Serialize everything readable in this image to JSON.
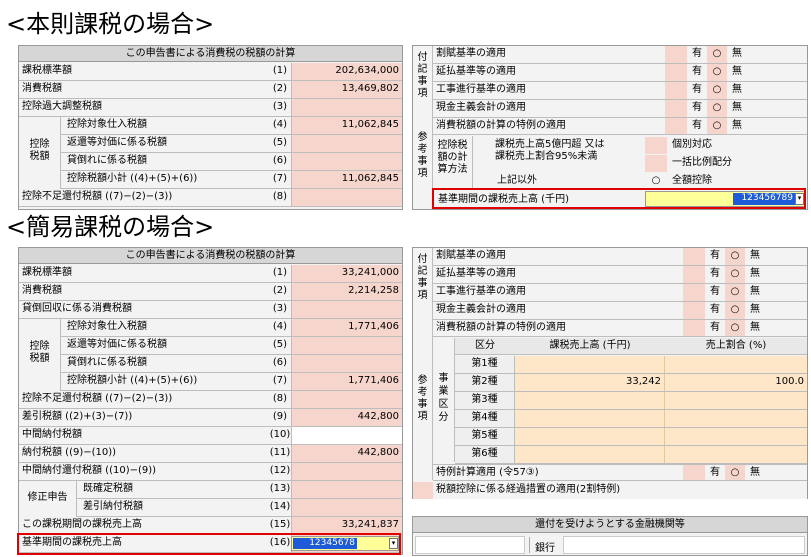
{
  "headings": {
    "honsoku": "<本則課税の場合>",
    "kani": "<簡易課税の場合>"
  },
  "calc": {
    "title": "この申告書による消費税の税額の計算",
    "koujo_group": "控除\n税額",
    "shusei_group": "修正申告"
  },
  "top_rows": [
    {
      "label": "課税標準額",
      "no": "(1)",
      "value": "202,634,000"
    },
    {
      "label": "消費税額",
      "no": "(2)",
      "value": "13,469,802"
    },
    {
      "label": "控除過大調整税額",
      "no": "(3)",
      "value": ""
    },
    {
      "label": "控除対象仕入税額",
      "no": "(4)",
      "value": "11,062,845"
    },
    {
      "label": "返還等対価に係る税額",
      "no": "(5)",
      "value": ""
    },
    {
      "label": "貸倒れに係る税額",
      "no": "(6)",
      "value": ""
    },
    {
      "label": "控除税額小計 ((4)+(5)+(6))",
      "no": "(7)",
      "value": "11,062,845"
    },
    {
      "label": "控除不足還付税額 ((7)−(2)−(3))",
      "no": "(8)",
      "value": ""
    }
  ],
  "bottom_rows": [
    {
      "label": "課税標準額",
      "no": "(1)",
      "value": "33,241,000"
    },
    {
      "label": "消費税額",
      "no": "(2)",
      "value": "2,214,258"
    },
    {
      "label": "貸倒回収に係る消費税額",
      "no": "(3)",
      "value": ""
    },
    {
      "label": "控除対象仕入税額",
      "no": "(4)",
      "value": "1,771,406"
    },
    {
      "label": "返還等対価に係る税額",
      "no": "(5)",
      "value": ""
    },
    {
      "label": "貸倒れに係る税額",
      "no": "(6)",
      "value": ""
    },
    {
      "label": "控除税額小計 ((4)+(5)+(6))",
      "no": "(7)",
      "value": "1,771,406"
    },
    {
      "label": "控除不足還付税額 ((7)−(2)−(3))",
      "no": "(8)",
      "value": ""
    },
    {
      "label": "差引税額 ((2)+(3)−(7))",
      "no": "(9)",
      "value": "442,800"
    },
    {
      "label": "中間納付税額",
      "no": "(10)",
      "value": ""
    },
    {
      "label": "納付税額 ((9)−(10))",
      "no": "(11)",
      "value": "442,800"
    },
    {
      "label": "中間納付還付税額 ((10)−(9))",
      "no": "(12)",
      "value": ""
    },
    {
      "label": "既確定税額",
      "no": "(13)",
      "value": ""
    },
    {
      "label": "差引納付税額",
      "no": "(14)",
      "value": ""
    },
    {
      "label": "この課税期間の課税売上高",
      "no": "(15)",
      "value": "33,241,837"
    },
    {
      "label": "基準期間の課税売上高",
      "no": "(16)",
      "value": "12345678"
    }
  ],
  "fuki": {
    "vertical": "付\n記\n事\n項",
    "items": [
      "割賦基準の適用",
      "延払基準等の適用",
      "工事進行基準の適用",
      "現金主義会計の適用"
    ],
    "yes": "有",
    "circle": "○",
    "no": "無"
  },
  "sanko_top": {
    "vertical": "参\n考\n事\n項",
    "tokurei": "消費税額の計算の特例の適用",
    "hoho": "控除税\n額の計\n算方法",
    "cond": "課税売上高5億円超 又は\n課税売上割合95%未満",
    "kobetsu": "個別対応",
    "ikkatsu": "一括比例配分",
    "jouki_igai": "上記以外",
    "zengaku": "全額控除",
    "kijun_label": "基準期間の課税売上高 (千円)",
    "kijun_value": "123456789"
  },
  "sanko_bottom": {
    "vertical": "参\n考\n事\n項",
    "tokurei": "消費税額の計算の特例の適用",
    "jigyo": "事\n業\n区\n分",
    "col_kubun": "区分",
    "col_uriage": "課税売上高 (千円)",
    "col_wariai": "売上割合 (%)",
    "types": [
      "第1種",
      "第2種",
      "第3種",
      "第4種",
      "第5種",
      "第6種"
    ],
    "type2_value": "33,242",
    "type2_ratio": "100.0",
    "tokurei_keisan": "特例計算適用 (令57③)",
    "keika": "税額控除に係る経過措置の適用(2割特例)"
  },
  "bank": {
    "title": "還付を受けようとする金融機関等",
    "bank_label": "銀行"
  },
  "colors": {
    "accent_red": "#e00000",
    "pink": "#f6d5cc",
    "selected": "#1e5bd8"
  }
}
